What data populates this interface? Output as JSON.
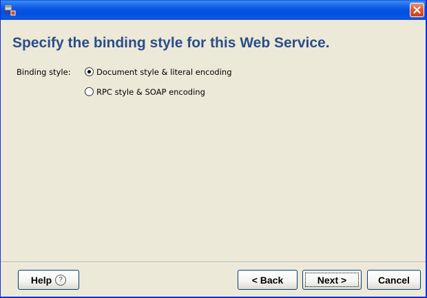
{
  "window": {
    "title": "",
    "icon": "wizard-icon",
    "close_icon": "close-icon"
  },
  "page": {
    "heading": "Specify the binding style for this Web Service."
  },
  "binding": {
    "label": "Binding style:",
    "options": [
      {
        "label": "Document style & literal encoding",
        "selected": true
      },
      {
        "label": "RPC style & SOAP encoding",
        "selected": false
      }
    ]
  },
  "buttons": {
    "help": "Help",
    "help_icon": "question-circle-icon",
    "help_glyph": "?",
    "back": "< Back",
    "next": "Next >",
    "cancel": "Cancel"
  },
  "colors": {
    "titlebar": "#0a58e8",
    "heading": "#2b4d88",
    "dialog_bg": "#ece9d8",
    "close_button": "#e0613b"
  }
}
